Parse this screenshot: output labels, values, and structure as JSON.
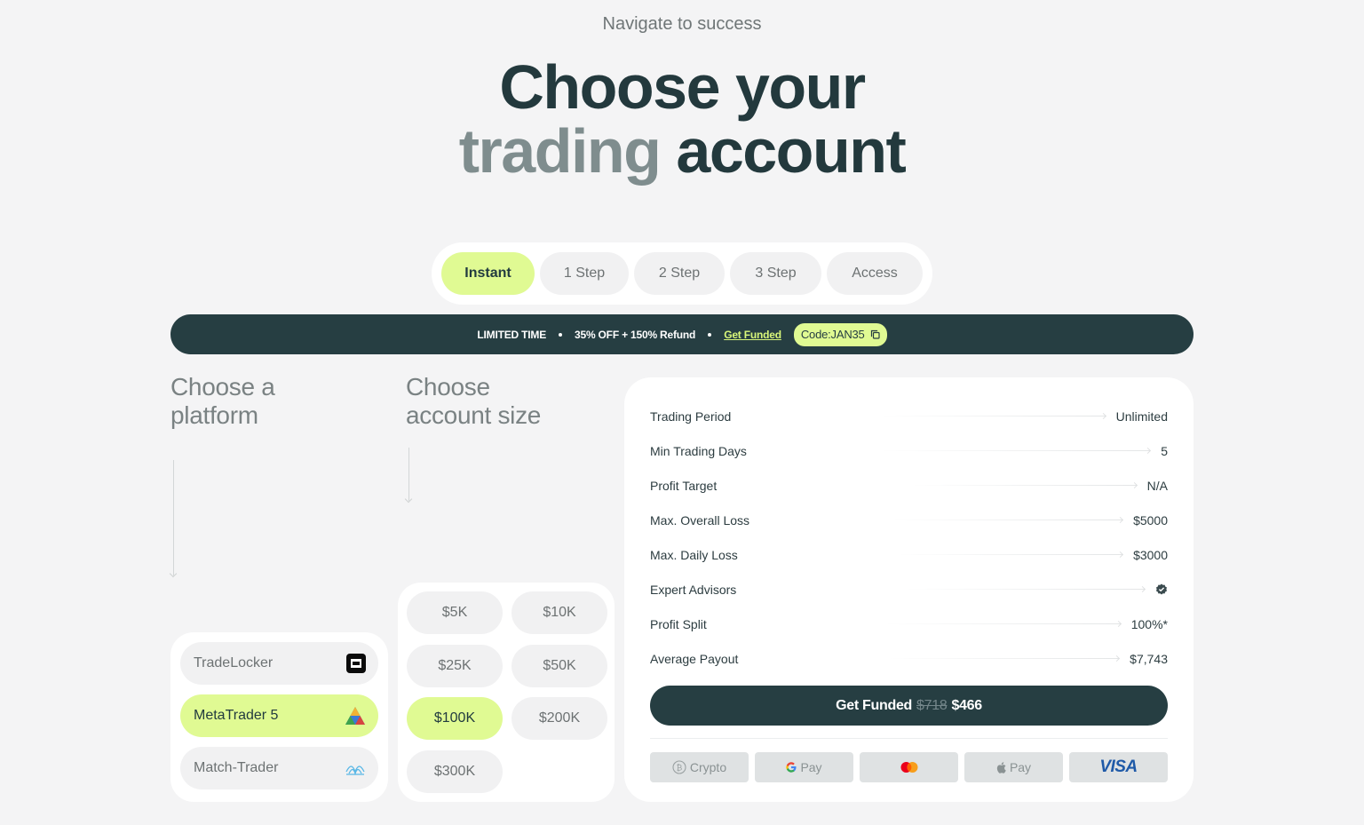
{
  "header": {
    "eyebrow": "Navigate to success",
    "title_line1": "Choose your",
    "title_line2_muted": "trading",
    "title_line2": "account"
  },
  "tabs": [
    {
      "label": "Instant",
      "active": true
    },
    {
      "label": "1 Step",
      "active": false
    },
    {
      "label": "2 Step",
      "active": false
    },
    {
      "label": "3 Step",
      "active": false
    },
    {
      "label": "Access",
      "active": false
    }
  ],
  "banner": {
    "limited": "LIMITED TIME",
    "offer": "35% OFF + 150% Refund",
    "link": "Get Funded",
    "code": "Code:JAN35"
  },
  "platform_section": {
    "title_line1": "Choose a",
    "title_line2": "platform",
    "items": [
      {
        "label": "TradeLocker",
        "icon": "tradelocker-icon",
        "active": false
      },
      {
        "label": "MetaTrader 5",
        "icon": "metatrader-icon",
        "active": true
      },
      {
        "label": "Match-Trader",
        "icon": "match-trader-icon",
        "active": false
      }
    ]
  },
  "size_section": {
    "title_line1": "Choose",
    "title_line2": "account size",
    "items": [
      {
        "label": "$5K",
        "active": false
      },
      {
        "label": "$10K",
        "active": false
      },
      {
        "label": "$25K",
        "active": false
      },
      {
        "label": "$50K",
        "active": false
      },
      {
        "label": "$100K",
        "active": true
      },
      {
        "label": "$200K",
        "active": false
      },
      {
        "label": "$300K",
        "active": false
      }
    ]
  },
  "details": {
    "rows": [
      {
        "label": "Trading Period",
        "value": "Unlimited"
      },
      {
        "label": "Min Trading Days",
        "value": "5"
      },
      {
        "label": "Profit Target",
        "value": "N/A"
      },
      {
        "label": "Max. Overall Loss",
        "value": "$5000"
      },
      {
        "label": "Max. Daily Loss",
        "value": "$3000"
      },
      {
        "label": "Expert Advisors",
        "value": "",
        "icon": "check-badge-icon"
      },
      {
        "label": "Profit Split",
        "value": "100%*"
      },
      {
        "label": "Average Payout",
        "value": "$7,743"
      }
    ],
    "cta": {
      "label": "Get Funded",
      "old_price": "$718",
      "price": "$466"
    },
    "payments": {
      "crypto": "Crypto",
      "gpay": "Pay",
      "applepay": "Pay",
      "visa": "VISA"
    }
  },
  "colors": {
    "accent": "#e0fa93",
    "dark": "#263e42",
    "background": "#f4f4f5"
  }
}
